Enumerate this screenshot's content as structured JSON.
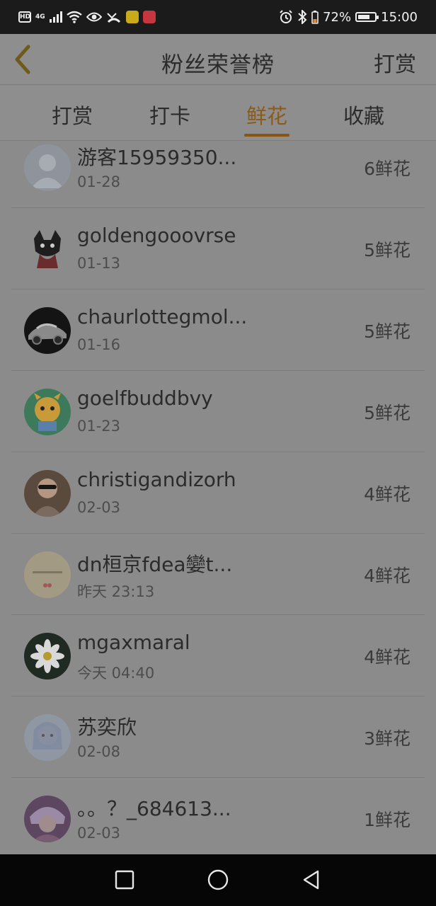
{
  "status_bar": {
    "hd": "HD",
    "network": "4G",
    "battery_level": 0.72,
    "battery_text": "72%",
    "time": "15:00",
    "app_badge_colors": [
      "#c9ab1a",
      "#c7363f"
    ]
  },
  "header": {
    "title": "粉丝荣誉榜",
    "action": "打赏",
    "back_icon": "chevron-left-icon"
  },
  "tabs": [
    {
      "label": "打赏",
      "active": false
    },
    {
      "label": "打卡",
      "active": false
    },
    {
      "label": "鲜花",
      "active": true
    },
    {
      "label": "收藏",
      "active": false
    }
  ],
  "colors": {
    "accent": "#8a5510",
    "overlay_background": "#8b8b8b"
  },
  "list": [
    {
      "name": "游客15959350...",
      "date": "01-28",
      "count": "6鲜花"
    },
    {
      "name": "goldengooovrse",
      "date": "01-13",
      "count": "5鲜花"
    },
    {
      "name": "chaurlottegmol...",
      "date": "01-16",
      "count": "5鲜花"
    },
    {
      "name": "goelfbuddbvy",
      "date": "01-23",
      "count": "5鲜花"
    },
    {
      "name": "christigandizorh",
      "date": "02-03",
      "count": "4鲜花"
    },
    {
      "name": "dn桓京fdea孌t...",
      "date": "昨天 23:13",
      "count": "4鲜花"
    },
    {
      "name": "mgaxmaral",
      "date": "今天 04:40",
      "count": "4鲜花"
    },
    {
      "name": "苏奕欣",
      "date": "02-08",
      "count": "3鲜花"
    },
    {
      "name": "。。？_684613...",
      "date": "02-03",
      "count": "1鲜花"
    }
  ],
  "nav_bar": {
    "buttons": [
      "recent-apps-icon",
      "home-icon",
      "back-icon"
    ]
  }
}
